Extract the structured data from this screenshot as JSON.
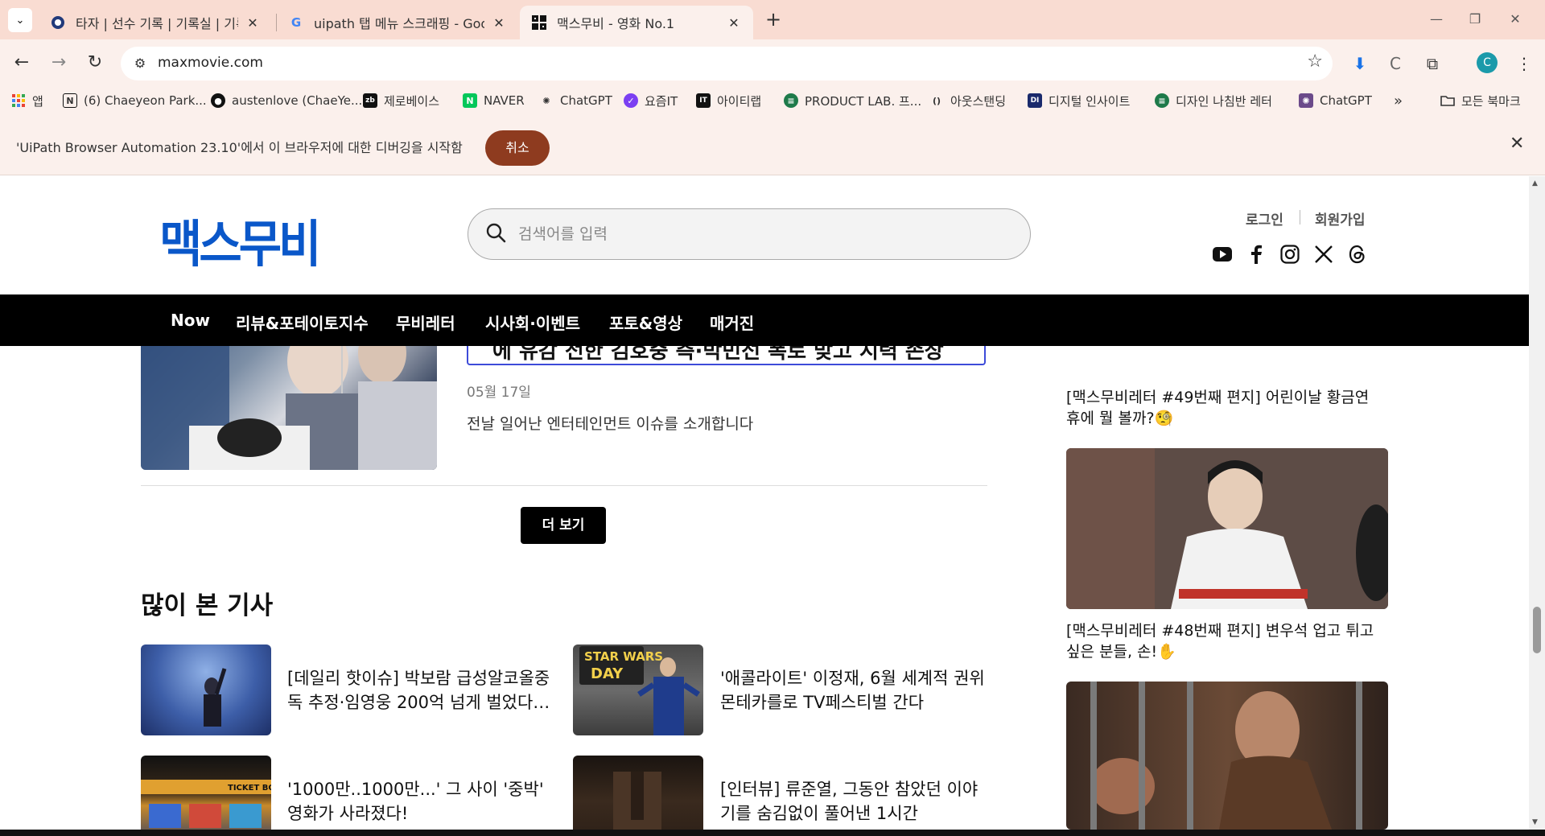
{
  "browser": {
    "tabs": [
      {
        "title": "타자 | 선수 기록 | 기록실 | 기록",
        "favicon": "circle-icon"
      },
      {
        "title": "uipath 탭 메뉴 스크래핑 - Goo",
        "favicon": "google-icon"
      },
      {
        "title": "맥스무비 - 영화 No.1",
        "favicon": "maxmovie-icon"
      }
    ],
    "url": "maxmovie.com",
    "bookmarks": [
      {
        "label": "앱"
      },
      {
        "label": "(6) Chaeyeon Park..."
      },
      {
        "label": "austenlove (ChaeYe..."
      },
      {
        "label": "제로베이스"
      },
      {
        "label": "NAVER"
      },
      {
        "label": "ChatGPT"
      },
      {
        "label": "요즘IT"
      },
      {
        "label": "아이티랩"
      },
      {
        "label": "PRODUCT LAB. 프..."
      },
      {
        "label": "아웃스탠딩"
      },
      {
        "label": "디지털 인사이트"
      },
      {
        "label": "디자인 나침반 레터"
      },
      {
        "label": "ChatGPT"
      }
    ],
    "bookmarks_overflow": "»",
    "all_bookmarks": "모든 북마크",
    "profile_initial": "C",
    "infobar": {
      "message": "'UiPath Browser Automation 23.10'에서 이 브라우저에 대한 디버깅을 시작함",
      "cancel": "취소"
    }
  },
  "site": {
    "logo": "맥스무비",
    "search_placeholder": "검색어를 입력",
    "auth": {
      "login": "로그인",
      "signup": "회원가입"
    },
    "social": [
      "youtube-icon",
      "facebook-icon",
      "instagram-icon",
      "x-icon",
      "threads-icon"
    ],
    "nav": [
      "Now",
      "리뷰&포테이토지수",
      "무비레터",
      "시사회·이벤트",
      "포토&영상",
      "매거진"
    ],
    "brand_color": "#0a57c9"
  },
  "article": {
    "title_fragment": "에 유감 전한 김호중 측·박민선 폭로 맞고 시력 손상",
    "date": "05월 17일",
    "description": "전날 일어난 엔터테인먼트 이슈를 소개합니다"
  },
  "more_button": "더 보기",
  "popular": {
    "title": "많이 본 기사",
    "items": [
      {
        "line1": "[데일리 핫이슈] 박보람 급성알코올중",
        "line2": "독 추정·임영웅 200억 넘게 벌었다…"
      },
      {
        "line1": "'애콜라이트' 이정재, 6월 세계적 권위",
        "line2": "몬테카를로 TV페스티벌 간다"
      },
      {
        "line1": "'1000만..1000만...' 그 사이 '중박'",
        "line2": "영화가 사라졌다!"
      },
      {
        "line1": "[인터뷰] 류준열, 그동안 참았던 이야",
        "line2": "기를 숨김없이 풀어낸 1시간"
      }
    ],
    "image_text": [
      "STAR WARS",
      "DAY",
      "TICKET BOX"
    ]
  },
  "sidebar": {
    "letters": [
      {
        "line1": "[맥스무비레터 #49번째 편지] 어린이날 황금연",
        "line2": "휴에 뭘 볼까?🧐"
      },
      {
        "line1": "[맥스무비레터 #48번째 편지] 변우석 업고 튀고",
        "line2": "싶은 분들, 손!✋"
      }
    ]
  }
}
